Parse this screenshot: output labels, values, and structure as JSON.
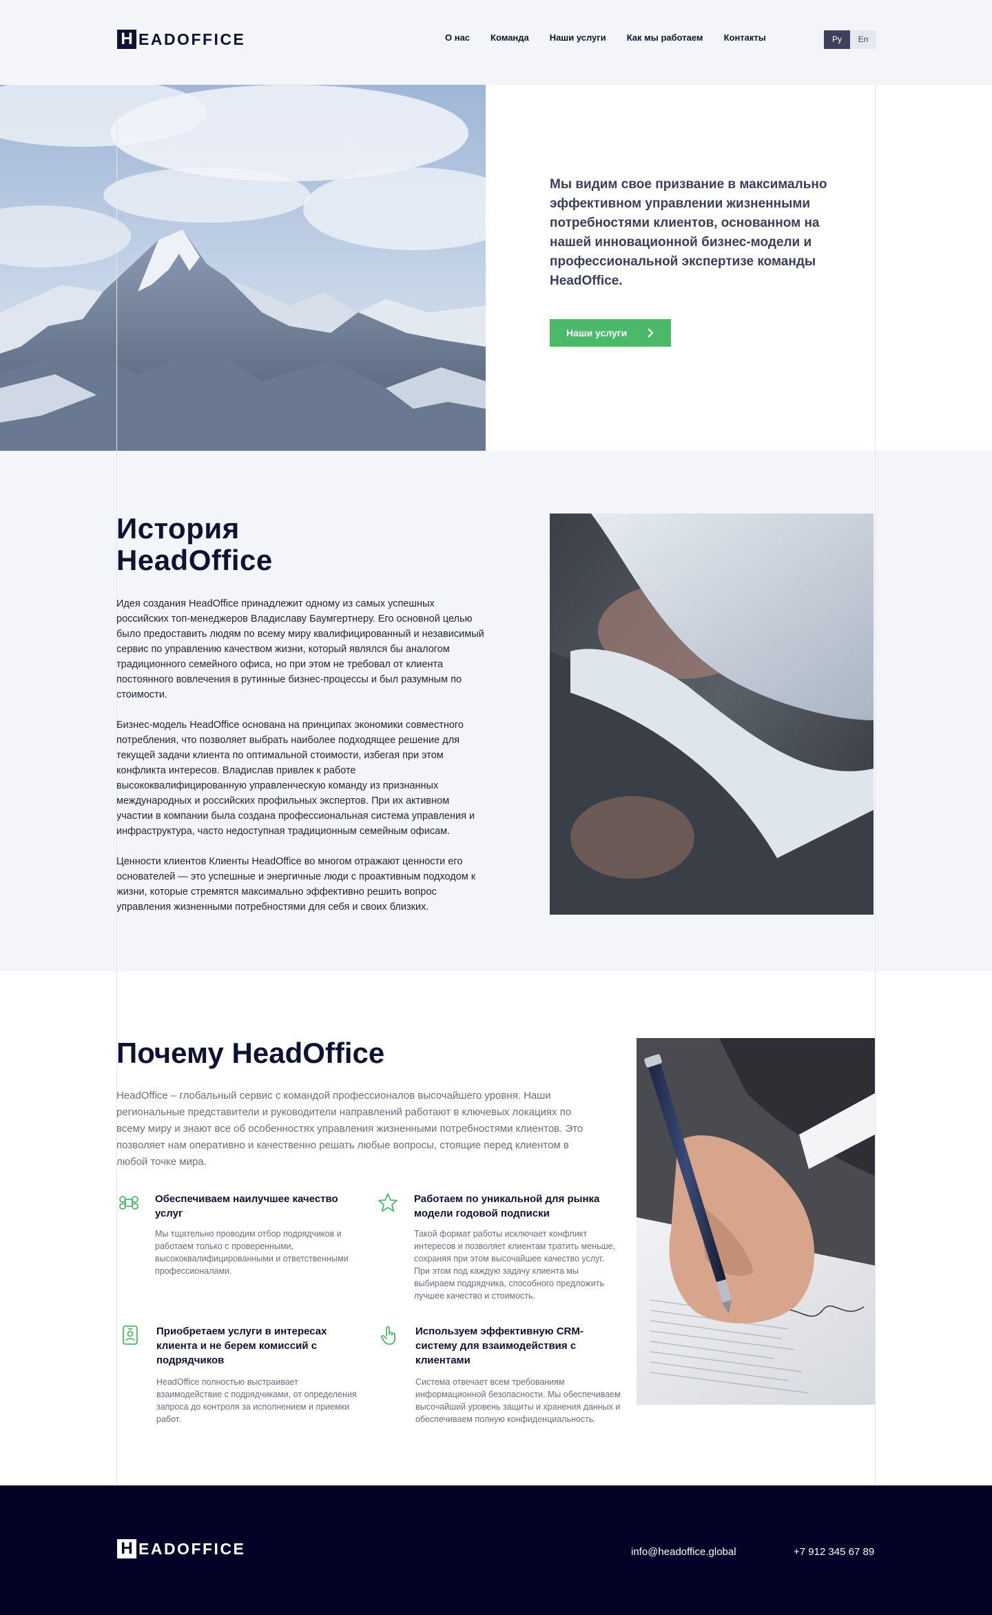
{
  "header": {
    "logo_mark": "H",
    "logo_text": "EADOFFICE",
    "nav": [
      "О нас",
      "Команда",
      "Наши услуги",
      "Как мы работаем",
      "Контакты"
    ],
    "lang_active": "Ру",
    "lang_inactive": "En"
  },
  "hero": {
    "text": "Мы видим свое призвание в максимально эффективном управлении жизненными потребностями клиентов, основанном на нашей инновационной бизнес-модели и профессиональной экспертизе команды HeadOffice.",
    "button_label": "Наши услуги"
  },
  "history": {
    "title_line1": "История",
    "title_line2": "HeadOffice",
    "paragraphs": [
      "Идея создания HeadOffice принадлежит одному из самых успешных российских топ-менеджеров Владиславу Баумгертнеру. Его основной целью было предоставить людям по всему миру квалифицированный и независимый сервис по управлению качеством жизни, который являлся бы аналогом традиционного семейного офиса, но при этом не требовал от клиента постоянного вовлечения в рутинные бизнес-процессы и был разумным по стоимости.",
      "Бизнес-модель HeadOffice основана на принципах экономики совместного потребления, что позволяет выбрать наиболее подходящее решение для текущей задачи клиента по оптимальной стоимости, избегая при этом конфликта интересов. Владислав привлек к работе высококвалифицированную управленческую команду из признанных международных и российских профильных экспертов. При их активном участии в компании была создана профессиональная система управления и инфраструктура, часто недоступная традиционным семейным офисам.",
      "Ценности клиентов Клиенты HeadOffice во многом отражают ценности его основателей — это успешные и энергичные люди с проактивным подходом к жизни, которые стремятся максимально эффективно решить вопрос управления жизненными потребностями для себя и своих близких."
    ]
  },
  "why": {
    "title": "Почему HeadOffice",
    "intro": "HeadOffice – глобальный сервис с командой профессионалов высочайшего уровня. Наши региональные представители и руководители направлений работают в ключевых локациях по всему миру и знают все об особенностях управления жизненными потребностями клиентов. Это позволяет нам оперативно и качественно решать любые вопросы, стоящие перед клиентом в любой точке мира.",
    "features": [
      {
        "title": "Обеспечиваем наилучшее качество услуг",
        "text": "Мы тщательно проводим отбор подрядчиков и работаем только с проверенными, высококвалифицированными и ответственными профессионалами.",
        "icon": "command-icon"
      },
      {
        "title": "Работаем по уникальной для рынка модели годовой подписки",
        "text": "Такой формат работы исключает конфликт интересов и позволяет клиентам тратить меньше, сохраняя при этом высочайшее качество услуг.  При этом под каждую задачу клиента мы выбираем подрядчика, способного предложить лучшее качество и стоимость.",
        "icon": "star-icon"
      },
      {
        "title": "Приобретаем услуги в интересах клиента и не берем комиссий с подрядчиков",
        "text": "HeadOffice полностью выстраивает взаимодействие с подрядчиками, от определения запроса до контроля за исполнением и приемки работ.",
        "icon": "id-badge-icon"
      },
      {
        "title": "Используем эффективную CRM-систему для взаимодействия с клиентами",
        "text": "Система отвечает всем требованиям информационной безопасности. Мы обеспечиваем высочайший уровень защиты и хранения данных и обеспечиваем полную конфиденциальность.",
        "icon": "pointer-hand-icon"
      }
    ]
  },
  "footer": {
    "logo_mark": "H",
    "logo_text": "EADOFFICE",
    "email": "info@headoffice.global",
    "phone": "+7 912 345 67 89"
  },
  "colors": {
    "accent_green": "#4cb96a",
    "navy": "#0f1230",
    "footer_bg": "#020326"
  }
}
